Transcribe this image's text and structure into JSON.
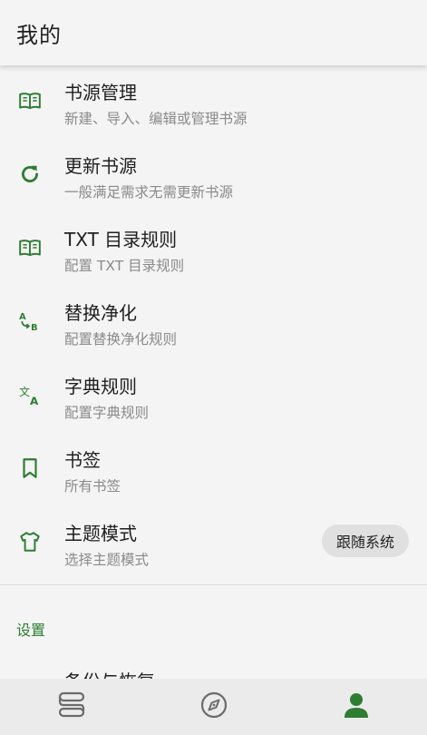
{
  "appbar": {
    "title": "我的"
  },
  "colors": {
    "accent": "#2e7d32",
    "icon_gray": "#6b6b6b",
    "background": "#f4f4f4",
    "chip_bg": "#e0e0e0"
  },
  "menu": {
    "items": [
      {
        "icon": "book-open-icon",
        "title": "书源管理",
        "subtitle": "新建、导入、编辑或管理书源"
      },
      {
        "icon": "refresh-icon",
        "title": "更新书源",
        "subtitle": "一般满足需求无需更新书源"
      },
      {
        "icon": "book-open-icon",
        "title": "TXT 目录规则",
        "subtitle": "配置 TXT 目录规则"
      },
      {
        "icon": "ab-replace-icon",
        "title": "替换净化",
        "subtitle": "配置替换净化规则"
      },
      {
        "icon": "translate-icon",
        "title": "字典规则",
        "subtitle": "配置字典规则"
      },
      {
        "icon": "bookmark-icon",
        "title": "书签",
        "subtitle": "所有书签"
      },
      {
        "icon": "tshirt-icon",
        "title": "主题模式",
        "subtitle": "选择主题模式",
        "value": "跟随系统"
      }
    ]
  },
  "settings": {
    "header": "设置",
    "items": [
      {
        "icon": "folder-icon",
        "title": "备份与恢复"
      }
    ]
  },
  "bottom_nav": {
    "items": [
      {
        "icon": "bookshelf-icon",
        "active": false
      },
      {
        "icon": "compass-icon",
        "active": false
      },
      {
        "icon": "person-icon",
        "active": true
      }
    ]
  }
}
